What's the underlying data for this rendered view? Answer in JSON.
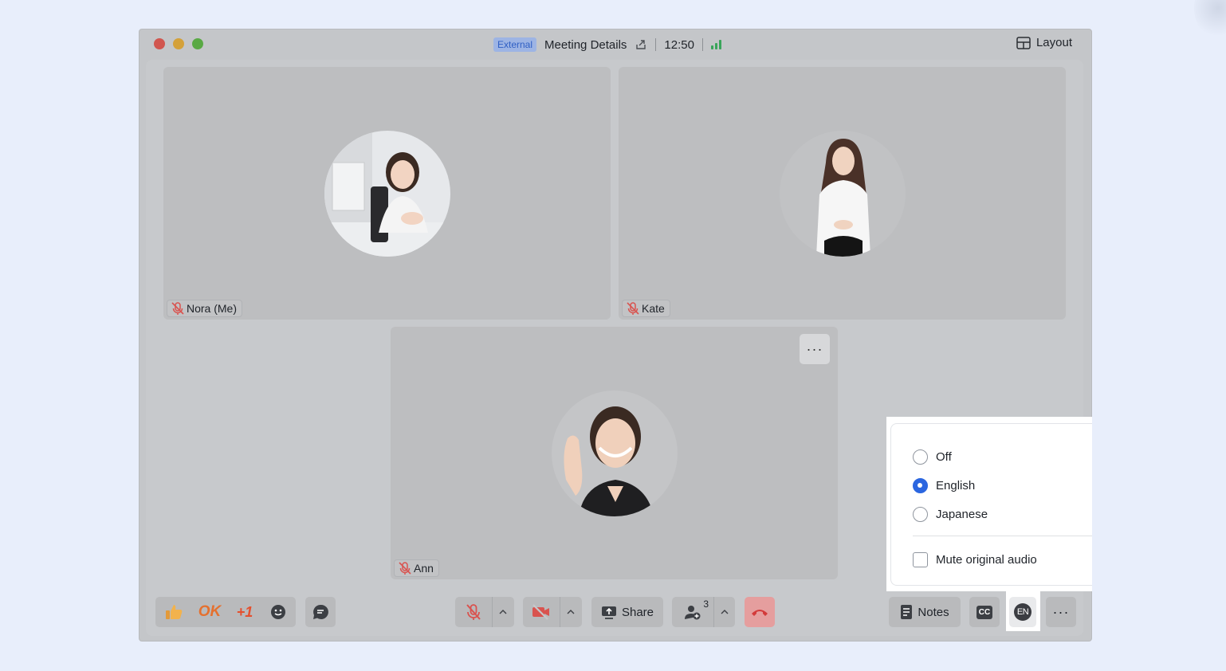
{
  "titlebar": {
    "badge": "External",
    "meeting_details": "Meeting Details",
    "time": "12:50",
    "layout_label": "Layout"
  },
  "participants": [
    {
      "name": "Nora (Me)",
      "muted": true
    },
    {
      "name": "Kate",
      "muted": true
    },
    {
      "name": "Ann",
      "muted": true
    }
  ],
  "toolbar": {
    "reaction_ok": "OK",
    "reaction_plus_one": "+1",
    "share_label": "Share",
    "participants_count": "3",
    "notes_label": "Notes",
    "cc_label": "CC",
    "language_label": "EN"
  },
  "interpretation_menu": {
    "options": [
      "Off",
      "English",
      "Japanese"
    ],
    "selected": "English",
    "mute_original_label": "Mute original audio",
    "mute_original_checked": false
  },
  "colors": {
    "accent": "#2b66e0",
    "signal": "#3aa55a",
    "end_call": "#e59e9e",
    "mute_red": "#d9534f"
  }
}
